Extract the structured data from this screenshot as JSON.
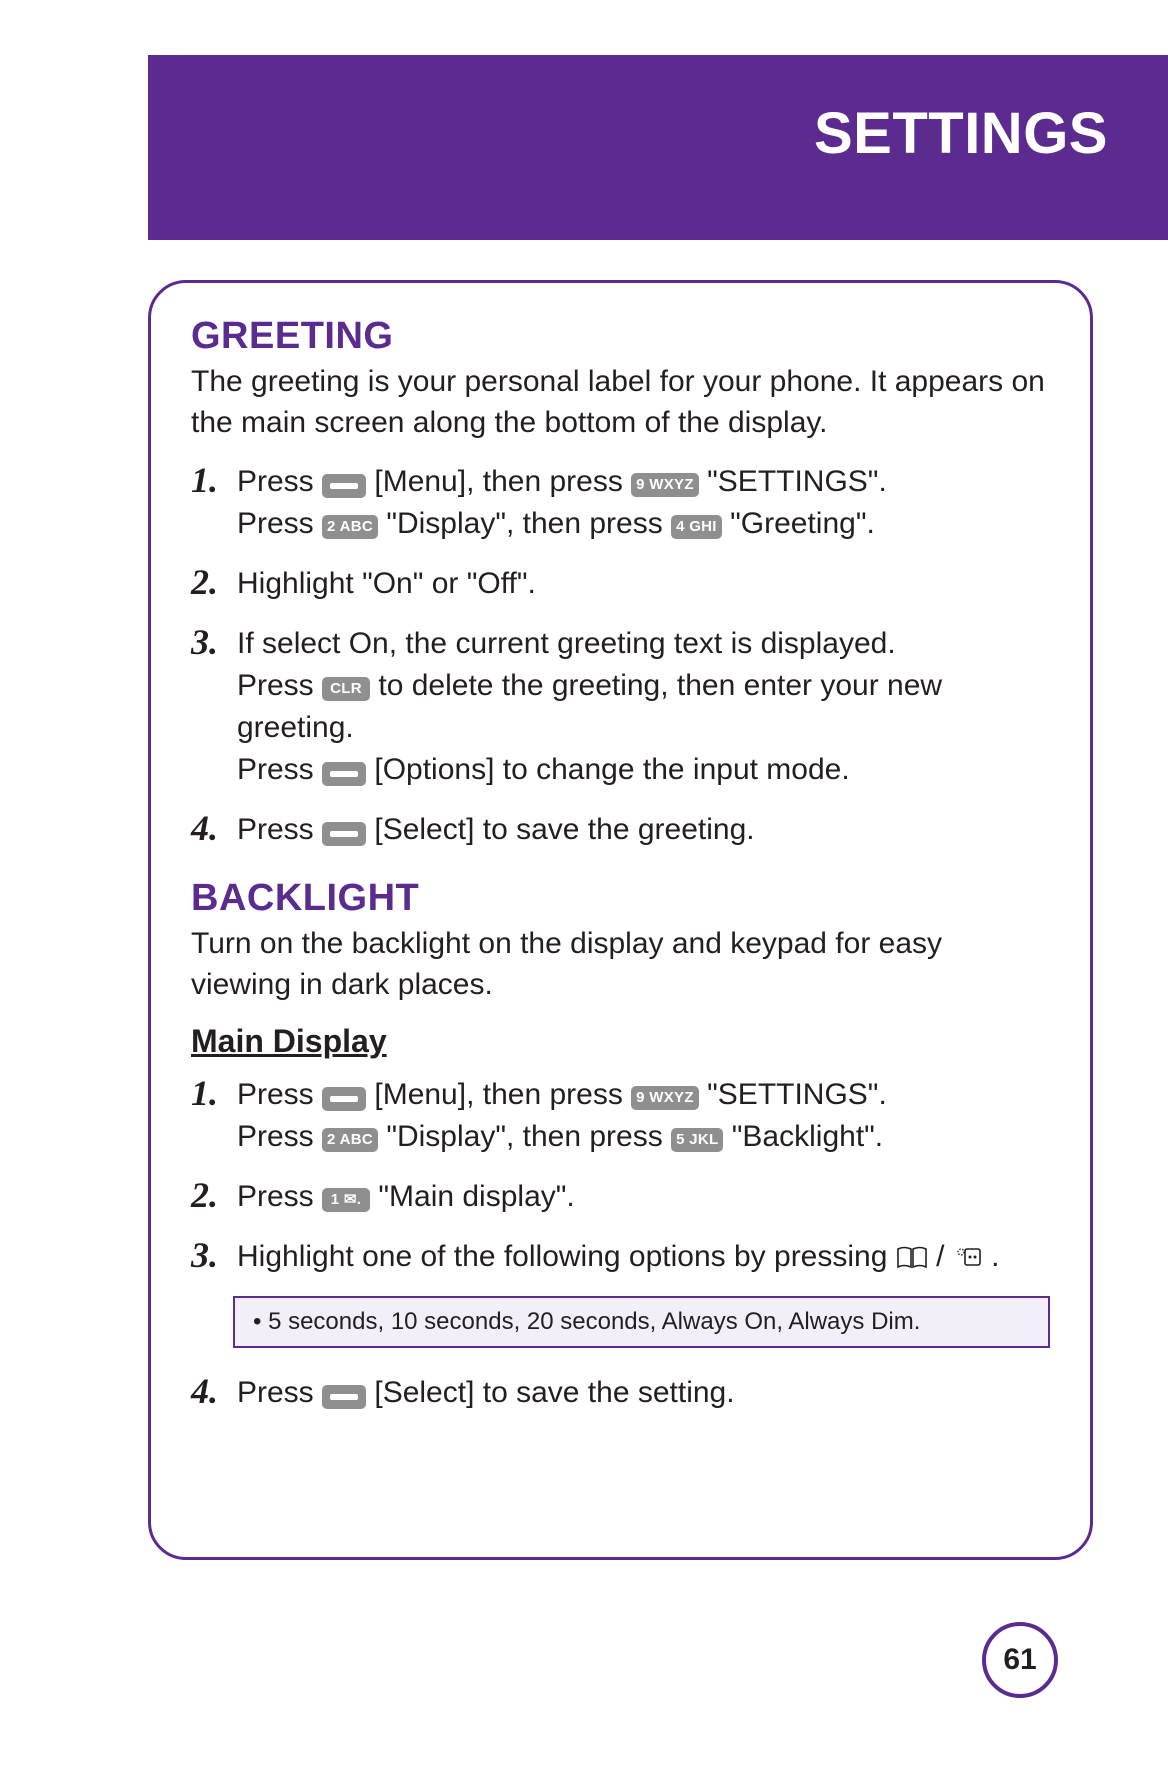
{
  "header": {
    "title": "SETTINGS"
  },
  "page_number": "61",
  "greeting": {
    "title": "GREETING",
    "intro": "The greeting is your personal label for your phone.  It appears on the main screen along the bottom of the display.",
    "steps": [
      {
        "n": "1.",
        "parts": [
          {
            "t": "Press "
          },
          {
            "key": "soft"
          },
          {
            "t": " [Menu], then press "
          },
          {
            "key": "9 WXYZ"
          },
          {
            "t": " \"SETTINGS\"."
          },
          {
            "br": true
          },
          {
            "t": "Press "
          },
          {
            "key": "2 ABC"
          },
          {
            "t": " \"Display\", then press "
          },
          {
            "key": "4 GHI"
          },
          {
            "t": " \"Greeting\"."
          }
        ]
      },
      {
        "n": "2.",
        "parts": [
          {
            "t": "Highlight \"On\" or \"Off\"."
          }
        ]
      },
      {
        "n": "3.",
        "parts": [
          {
            "t": "If select On, the current greeting text is displayed."
          },
          {
            "br": true
          },
          {
            "t": "Press "
          },
          {
            "key": "CLR"
          },
          {
            "t": " to delete the greeting, then enter your new greeting."
          },
          {
            "br": true
          },
          {
            "t": "Press "
          },
          {
            "key": "soft"
          },
          {
            "t": " [Options] to change the input mode."
          }
        ]
      },
      {
        "n": "4.",
        "parts": [
          {
            "t": "Press "
          },
          {
            "key": "soft"
          },
          {
            "t": " [Select] to save the greeting."
          }
        ]
      }
    ]
  },
  "backlight": {
    "title": "BACKLIGHT",
    "intro": "Turn on the backlight on the display and keypad for easy viewing in dark places.",
    "subtitle": "Main Display",
    "steps": [
      {
        "n": "1.",
        "parts": [
          {
            "t": "Press "
          },
          {
            "key": "soft"
          },
          {
            "t": " [Menu], then press "
          },
          {
            "key": "9 WXYZ"
          },
          {
            "t": " \"SETTINGS\"."
          },
          {
            "br": true
          },
          {
            "t": "Press "
          },
          {
            "key": "2 ABC"
          },
          {
            "t": " \"Display\", then press "
          },
          {
            "key": "5 JKL"
          },
          {
            "t": " \"Backlight\"."
          }
        ]
      },
      {
        "n": "2.",
        "parts": [
          {
            "t": "Press "
          },
          {
            "key": "1 ✉."
          },
          {
            "t": " \"Main display\"."
          }
        ]
      },
      {
        "n": "3.",
        "parts": [
          {
            "t": "Highlight one of the following options by pressing "
          },
          {
            "icon": "book"
          },
          {
            "t": " / "
          },
          {
            "icon": "right"
          },
          {
            "t": " ."
          }
        ]
      },
      {
        "n": "4.",
        "parts": [
          {
            "t": "Press "
          },
          {
            "key": "soft"
          },
          {
            "t": " [Select] to save the setting."
          }
        ]
      }
    ],
    "options_note": "• 5 seconds, 10 seconds, 20 seconds, Always On, Always Dim."
  }
}
